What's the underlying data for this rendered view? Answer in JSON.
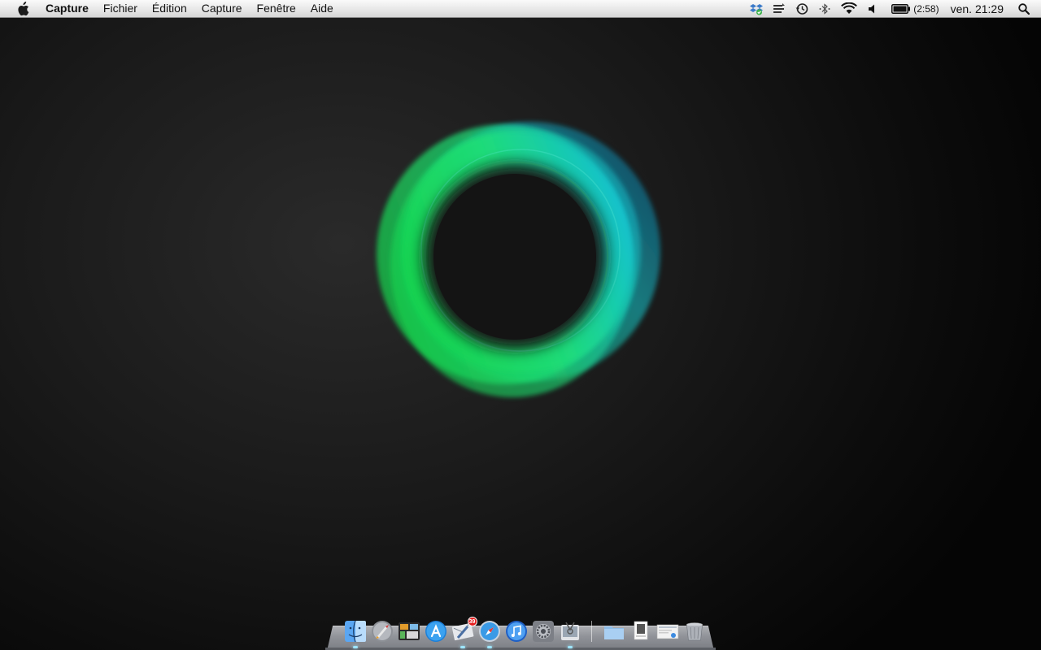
{
  "menubar": {
    "apple_icon": "apple-logo-icon",
    "app_name": "Capture",
    "menus": [
      "Fichier",
      "Édition",
      "Capture",
      "Fenêtre",
      "Aide"
    ],
    "status_icons": [
      "dropbox-icon",
      "scanner-icon",
      "time-machine-icon",
      "bluetooth-icon",
      "wifi-icon",
      "volume-icon"
    ],
    "battery": {
      "icon": "battery-icon",
      "time_remaining": "(2:58)"
    },
    "clock": "ven. 21:29",
    "spotlight_icon": "spotlight-search-icon"
  },
  "wallpaper": {
    "description_colors": {
      "green": "#1ee65a",
      "cyan": "#11c7e8",
      "blue": "#0a6aa8"
    }
  },
  "dock": {
    "apps": [
      {
        "name": "finder",
        "icon": "finder-icon",
        "running": true
      },
      {
        "name": "launchpad",
        "icon": "launchpad-icon",
        "running": false
      },
      {
        "name": "mission-control",
        "icon": "mission-control-icon",
        "running": false
      },
      {
        "name": "app-store",
        "icon": "app-store-icon",
        "running": false
      },
      {
        "name": "mail",
        "icon": "mail-icon",
        "running": true,
        "badge": "39"
      },
      {
        "name": "safari",
        "icon": "safari-icon",
        "running": true
      },
      {
        "name": "itunes",
        "icon": "itunes-icon",
        "running": false
      },
      {
        "name": "system-preferences",
        "icon": "system-preferences-icon",
        "running": false
      },
      {
        "name": "capture",
        "icon": "capture-icon",
        "running": true
      }
    ],
    "stacks": [
      {
        "name": "documents",
        "icon": "folder-stack-icon"
      },
      {
        "name": "downloads",
        "icon": "document-stack-icon"
      },
      {
        "name": "screenshots",
        "icon": "screenshot-stack-icon"
      },
      {
        "name": "trash",
        "icon": "trash-icon"
      }
    ]
  }
}
